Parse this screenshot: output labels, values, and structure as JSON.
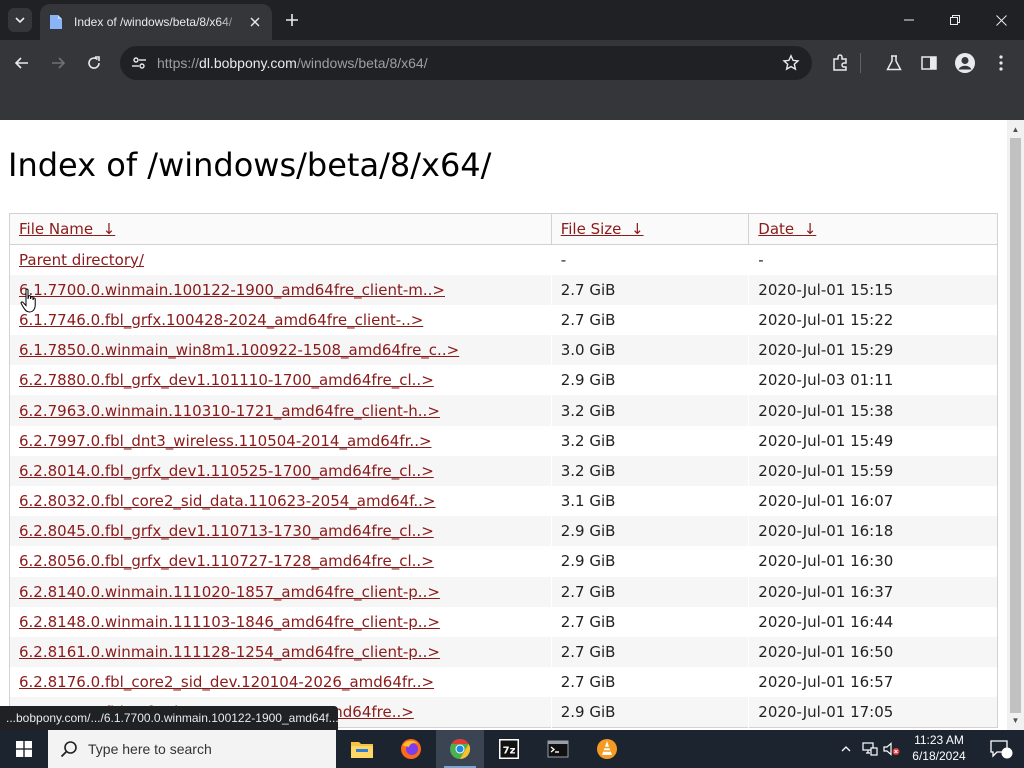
{
  "browser": {
    "tab_title": "Index of /windows/beta/8/x64/",
    "url_scheme": "https://",
    "url_host": "dl.bobpony.com",
    "url_path": "/windows/beta/8/x64/",
    "status_url": "...bobpony.com/.../6.1.7700.0.winmain.100122-1900_amd64f..."
  },
  "page": {
    "title": "Index of /windows/beta/8/x64/",
    "headers": {
      "name": "File Name",
      "size": "File Size",
      "date": "Date",
      "sort_arrow": "↓"
    },
    "rows": [
      {
        "name": "Parent directory/",
        "size": "-",
        "date": "-"
      },
      {
        "name": "6.1.7700.0.winmain.100122-1900_amd64fre_client-m..>",
        "size": "2.7 GiB",
        "date": "2020-Jul-01 15:15"
      },
      {
        "name": "6.1.7746.0.fbl_grfx.100428-2024_amd64fre_client-..>",
        "size": "2.7 GiB",
        "date": "2020-Jul-01 15:22"
      },
      {
        "name": "6.1.7850.0.winmain_win8m1.100922-1508_amd64fre_c..>",
        "size": "3.0 GiB",
        "date": "2020-Jul-01 15:29"
      },
      {
        "name": "6.2.7880.0.fbl_grfx_dev1.101110-1700_amd64fre_cl..>",
        "size": "2.9 GiB",
        "date": "2020-Jul-03 01:11"
      },
      {
        "name": "6.2.7963.0.winmain.110310-1721_amd64fre_client-h..>",
        "size": "3.2 GiB",
        "date": "2020-Jul-01 15:38"
      },
      {
        "name": "6.2.7997.0.fbl_dnt3_wireless.110504-2014_amd64fr..>",
        "size": "3.2 GiB",
        "date": "2020-Jul-01 15:49"
      },
      {
        "name": "6.2.8014.0.fbl_grfx_dev1.110525-1700_amd64fre_cl..>",
        "size": "3.2 GiB",
        "date": "2020-Jul-01 15:59"
      },
      {
        "name": "6.2.8032.0.fbl_core2_sid_data.110623-2054_amd64f..>",
        "size": "3.1 GiB",
        "date": "2020-Jul-01 16:07"
      },
      {
        "name": "6.2.8045.0.fbl_grfx_dev1.110713-1730_amd64fre_cl..>",
        "size": "2.9 GiB",
        "date": "2020-Jul-01 16:18"
      },
      {
        "name": "6.2.8056.0.fbl_grfx_dev1.110727-1728_amd64fre_cl..>",
        "size": "2.9 GiB",
        "date": "2020-Jul-01 16:30"
      },
      {
        "name": "6.2.8140.0.winmain.111020-1857_amd64fre_client-p..>",
        "size": "2.7 GiB",
        "date": "2020-Jul-01 16:37"
      },
      {
        "name": "6.2.8148.0.winmain.111103-1846_amd64fre_client-p..>",
        "size": "2.7 GiB",
        "date": "2020-Jul-01 16:44"
      },
      {
        "name": "6.2.8161.0.winmain.111128-1254_amd64fre_client-p..>",
        "size": "2.7 GiB",
        "date": "2020-Jul-01 16:50"
      },
      {
        "name": "6.2.8176.0.fbl_core2_sid_dev.120104-2026_amd64fr..>",
        "size": "2.7 GiB",
        "date": "2020-Jul-01 16:57"
      },
      {
        "name": "6.2.8180.0.fbl_grfx_dev1.120106-1520_amd64fre..>",
        "size": "2.9 GiB",
        "date": "2020-Jul-01 17:05"
      }
    ]
  },
  "taskbar": {
    "search_placeholder": "Type here to search",
    "time": "11:23 AM",
    "date": "6/18/2024",
    "notification_count": "7"
  },
  "colors": {
    "link": "#8b1a1a",
    "chrome_dark": "#202124",
    "chrome_toolbar": "#35363a",
    "taskbar": "#1c2430"
  }
}
